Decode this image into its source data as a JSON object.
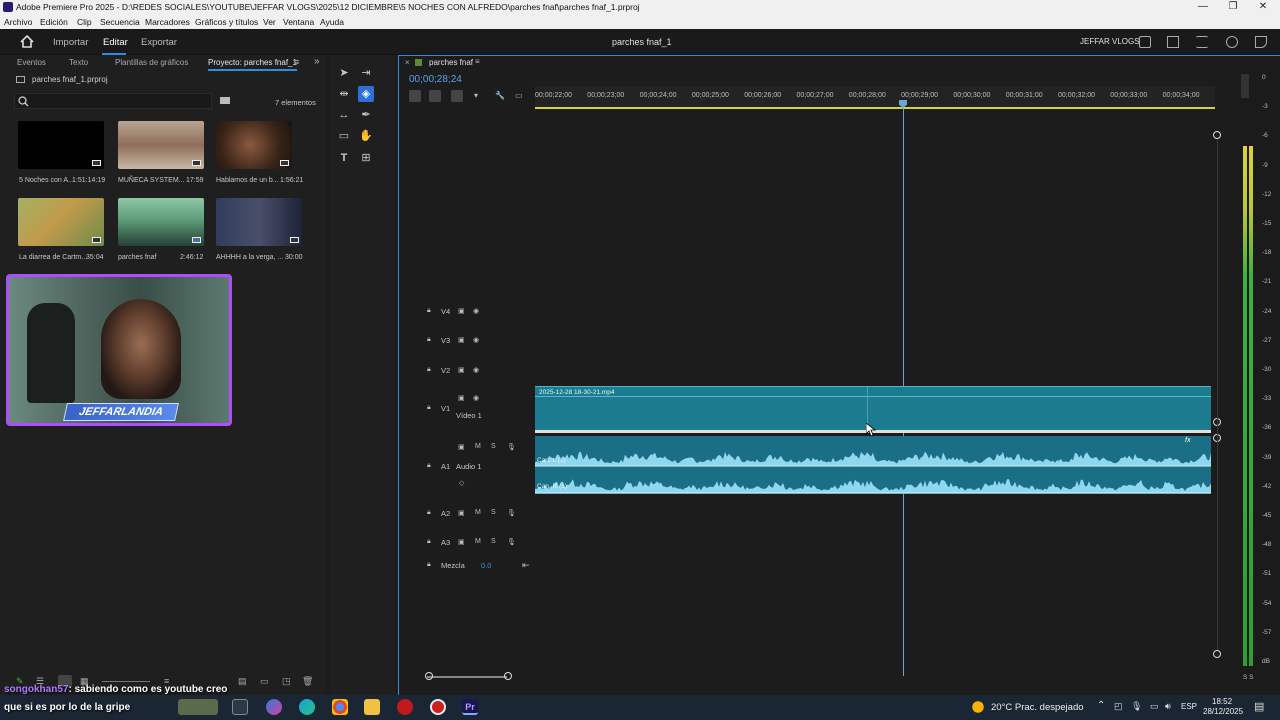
{
  "window": {
    "title": "Adobe Premiere Pro 2025 - D:\\REDES SOCIALES\\YOUTUBE\\JEFFAR VLOGS\\2025\\12 DICIEMBRE\\5 NOCHES CON ALFREDO\\parches fnaf\\parches fnaf_1.prproj",
    "controls": [
      "—",
      "❐",
      "✕"
    ]
  },
  "menu": [
    "Archivo",
    "Edición",
    "Clip",
    "Secuencia",
    "Marcadores",
    "Gráficos y títulos",
    "Ver",
    "Ventana",
    "Ayuda"
  ],
  "appbar": {
    "nav": [
      "Importar",
      "Editar",
      "Exportar"
    ],
    "active": "Editar",
    "project_title": "parches fnaf_1",
    "user": "JEFFAR VLOGS"
  },
  "project_panel": {
    "tabs": [
      "Eventos",
      "Texto",
      "Plantillas de gráficos",
      "Proyecto: parches fnaf_1"
    ],
    "file": "parches fnaf_1.prproj",
    "count": "7 elementos",
    "items": [
      {
        "name": "5 Noches con A...",
        "duration": "1:51:14:19",
        "color": "#000000"
      },
      {
        "name": "MUÑECA SYSTEM...",
        "duration": "17:59",
        "color": "#7a6a60"
      },
      {
        "name": "Hablamos de un b...",
        "duration": "1:56:21",
        "color": "#5a3a2a"
      },
      {
        "name": "La diarrea de Cartm...",
        "duration": "35:04",
        "color": "#7a8a4a"
      },
      {
        "name": "parches fnaf",
        "duration": "2:46:12",
        "color": "#3a7a5a"
      },
      {
        "name": "AHHHH a la verga, ...",
        "duration": "30:00",
        "color": "#2a3a5a"
      }
    ]
  },
  "webcam": {
    "overlay_text": "JEFFARLANDIA"
  },
  "timeline": {
    "tab": "parches fnaf",
    "timecode": "00;00;28;24",
    "ruler": [
      "00;00;22;00",
      "00;00;23;00",
      "00;00;24;00",
      "00;00;25;00",
      "00;00;26;00",
      "00;00;27;00",
      "00;00;28;00",
      "00;00;29;00",
      "00;00;30;00",
      "00;00;31;00",
      "00;00;32;00",
      "00;00;33;00",
      "00;00;34;00"
    ],
    "video_tracks": [
      "V4",
      "V3",
      "V2",
      "V1"
    ],
    "v1_name": "Vídeo 1",
    "clip_name": "2025-12-28 18-30-21.mp4",
    "audio_tracks": [
      "A1",
      "A2",
      "A3"
    ],
    "a1_name": "Audio 1",
    "channel_l": "Can. L (1)",
    "channel_r": "Can. R (1)",
    "mix_label": "Mezcla",
    "mix_value": "0.0"
  },
  "meters": {
    "scale": [
      "0",
      "-3",
      "-6",
      "-9",
      "-12",
      "-15",
      "-18",
      "-21",
      "-24",
      "-27",
      "-30",
      "-33",
      "-36",
      "-39",
      "-42",
      "-45",
      "-48",
      "-51",
      "-54",
      "-57",
      "dB"
    ],
    "footer": "S S"
  },
  "chat": {
    "user": "songokhan57",
    "message1": ": sabiendo como es youtube creo",
    "message2": "que si es por lo de la gripe"
  },
  "taskbar": {
    "weather": "20°C  Prac. despejado",
    "lang": "ESP",
    "time": "18:52",
    "date": "28/12/2025"
  },
  "colors": {
    "accent": "#2d8ceb",
    "clip_video": "#1d7b8f",
    "clip_audio": "#1a6f86",
    "playhead": "#6aa4d8",
    "meter_green": "#3fb03f",
    "meter_yellow": "#e0d23a"
  }
}
